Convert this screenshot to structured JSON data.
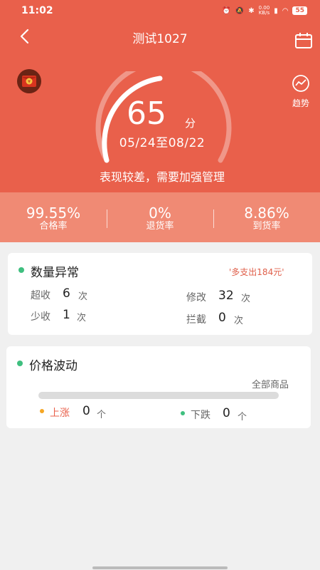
{
  "status_bar": {
    "time": "11:02",
    "network_speed_value": "0.00",
    "network_speed_unit": "KB/s",
    "battery": "55"
  },
  "header": {
    "title": "测试1027",
    "trend_label": "趋势"
  },
  "score": {
    "value": "65",
    "unit": "分",
    "date_range": "05/24至08/22",
    "message": "表现较差，需要加强管理"
  },
  "stats": [
    {
      "value": "99.55%",
      "label": "合格率"
    },
    {
      "value": "0%",
      "label": "退货率"
    },
    {
      "value": "8.86%",
      "label": "到货率"
    }
  ],
  "quantity_anomaly": {
    "title": "数量异常",
    "tag": "'多支出184元'",
    "items": [
      {
        "label": "超收",
        "value": "6",
        "unit": "次"
      },
      {
        "label": "修改",
        "value": "32",
        "unit": "次"
      },
      {
        "label": "少收",
        "value": "1",
        "unit": "次"
      },
      {
        "label": "拦截",
        "value": "0",
        "unit": "次"
      }
    ]
  },
  "price_fluctuation": {
    "title": "价格波动",
    "filter": "全部商品",
    "rise_fraction": 0,
    "rise": {
      "label": "上涨",
      "value": "0",
      "unit": "个"
    },
    "fall": {
      "label": "下跌",
      "value": "0",
      "unit": "个"
    }
  },
  "colors": {
    "primary": "#e9604b",
    "stats_band": "#f08a74",
    "green_dot": "#3fbf7f",
    "orange_dot": "#f5a623"
  }
}
